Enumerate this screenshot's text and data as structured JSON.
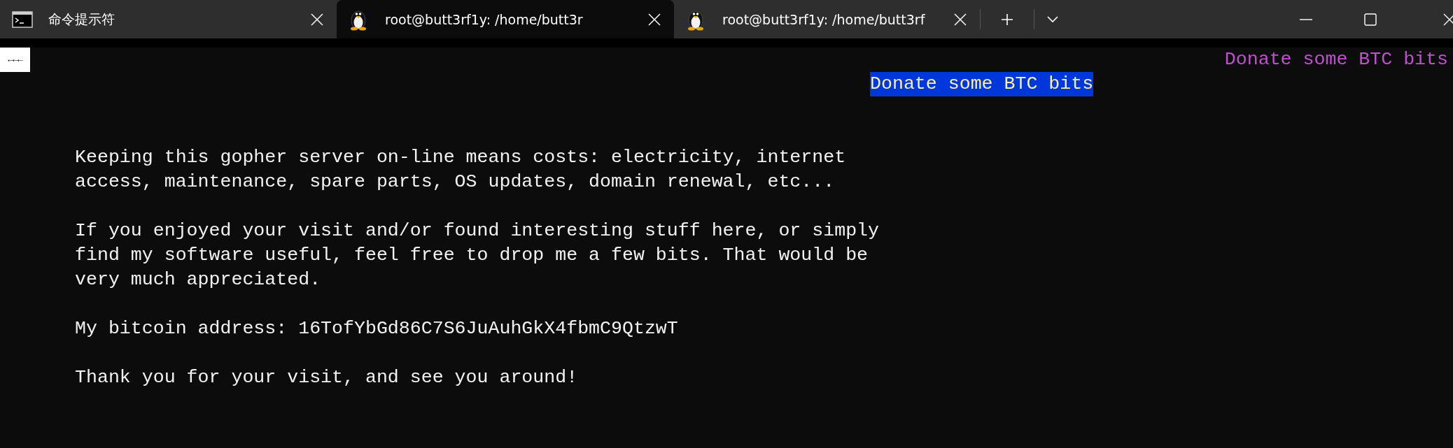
{
  "tabs": [
    {
      "title": "命令提示符",
      "kind": "cmd",
      "selected": false
    },
    {
      "title": "root@butt3rf1y: /home/butt3r",
      "kind": "linux",
      "selected": true
    },
    {
      "title": "root@butt3rf1y: /home/butt3rf",
      "kind": "linux",
      "selected": false
    }
  ],
  "terminal": {
    "back_marker": "←←←",
    "top_link": "Donate some BTC bits",
    "highlighted_link": "Donate some BTC bits",
    "paragraphs": [
      [
        "Keeping this gopher server on-line means costs: electricity, internet",
        "access, maintenance, spare parts, OS updates, domain renewal, etc..."
      ],
      [
        "If you enjoyed your visit and/or found interesting stuff here, or simply",
        "find my software useful, feel free to drop me a few bits. That would be",
        "very much appreciated."
      ],
      [
        "My bitcoin address: 16TofYbGd86C7S6JuAuhGkX4fbmC9QtzwT"
      ],
      [
        "Thank you for your visit, and see you around!"
      ]
    ]
  }
}
